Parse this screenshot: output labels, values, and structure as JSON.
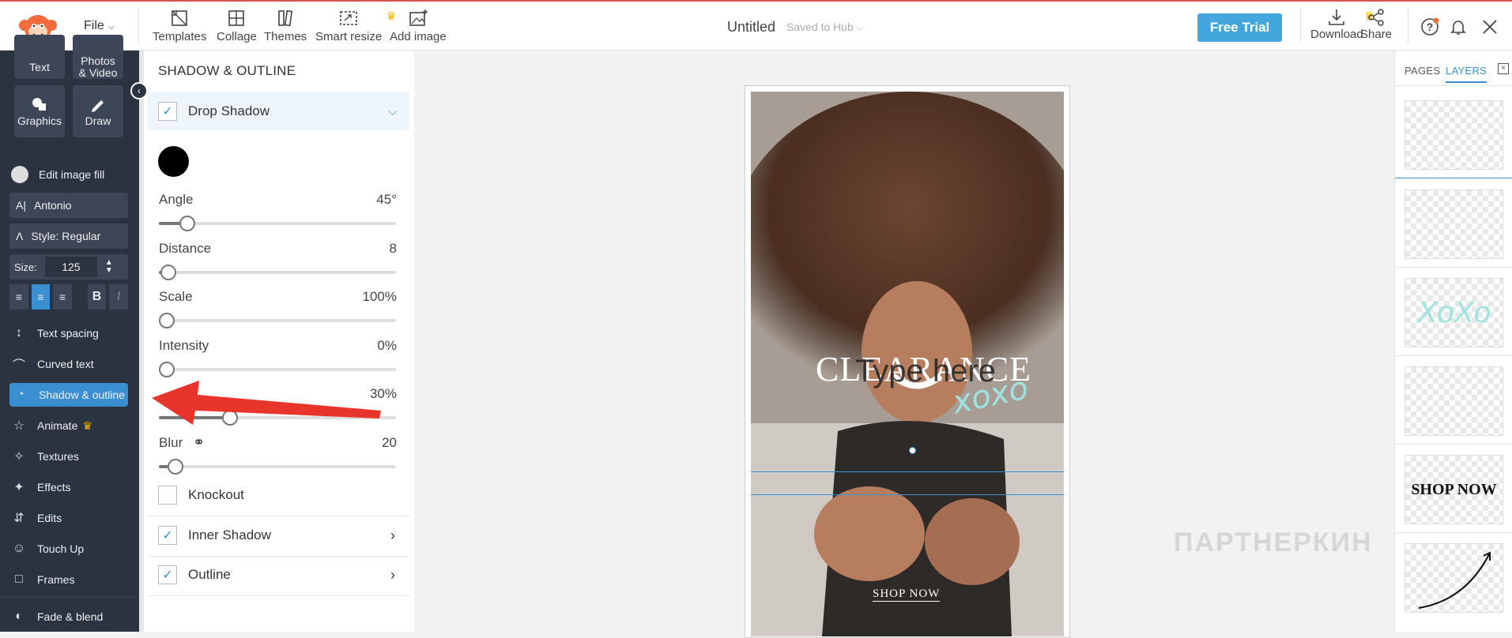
{
  "topbar": {
    "file_label": "File",
    "tools": [
      {
        "label": "Templates",
        "icon": "templates-icon"
      },
      {
        "label": "Collage",
        "icon": "collage-icon"
      },
      {
        "label": "Themes",
        "icon": "themes-icon"
      },
      {
        "label": "Smart resize",
        "icon": "smart-resize-icon"
      },
      {
        "label": "Add image",
        "icon": "add-image-icon"
      }
    ],
    "doc_title": "Untitled",
    "saved_status": "Saved to Hub",
    "free_trial": "Free Trial",
    "download": "Download",
    "share": "Share",
    "accent": "#43a6dd"
  },
  "sidebar": {
    "tiles": [
      "Text",
      "Photos & Video",
      "Graphics",
      "Draw"
    ],
    "edit_image_fill": "Edit image fill",
    "font": "Antonio",
    "style": "Style: Regular",
    "size_label": "Size:",
    "size_value": "125",
    "items": [
      "Text spacing",
      "Curved text",
      "Shadow & outline",
      "Animate",
      "Textures",
      "Effects",
      "Edits",
      "Touch Up",
      "Frames",
      "Fade & blend"
    ],
    "active_item": "Shadow & outline"
  },
  "panel": {
    "title": "SHADOW & OUTLINE",
    "drop_shadow": "Drop Shadow",
    "shadow_color": "#000000",
    "sliders": [
      {
        "label": "Angle",
        "value": "45°",
        "fraction": 0.12
      },
      {
        "label": "Distance",
        "value": "8",
        "fraction": 0.04
      },
      {
        "label": "Scale",
        "value": "100%",
        "fraction": 0.0
      },
      {
        "label": "Intensity",
        "value": "0%",
        "fraction": 0.0
      },
      {
        "label": "",
        "value": "30%",
        "fraction": 0.3
      },
      {
        "label": "Blur",
        "value": "20",
        "fraction": 0.07
      }
    ],
    "knockout": "Knockout",
    "inner_shadow": "Inner Shadow",
    "outline": "Outline"
  },
  "canvas": {
    "headline": "CLEARANCE",
    "overlay_text": "Type here",
    "script_text": "xoxo",
    "cta": "SHOP NOW",
    "watermark": "ПАРТНЕРКИН"
  },
  "right_panel": {
    "tab_pages": "PAGES",
    "tab_layers": "LAYERS",
    "layer_shop_now": "SHOP NOW",
    "layer_xoxo": "XoXo"
  }
}
